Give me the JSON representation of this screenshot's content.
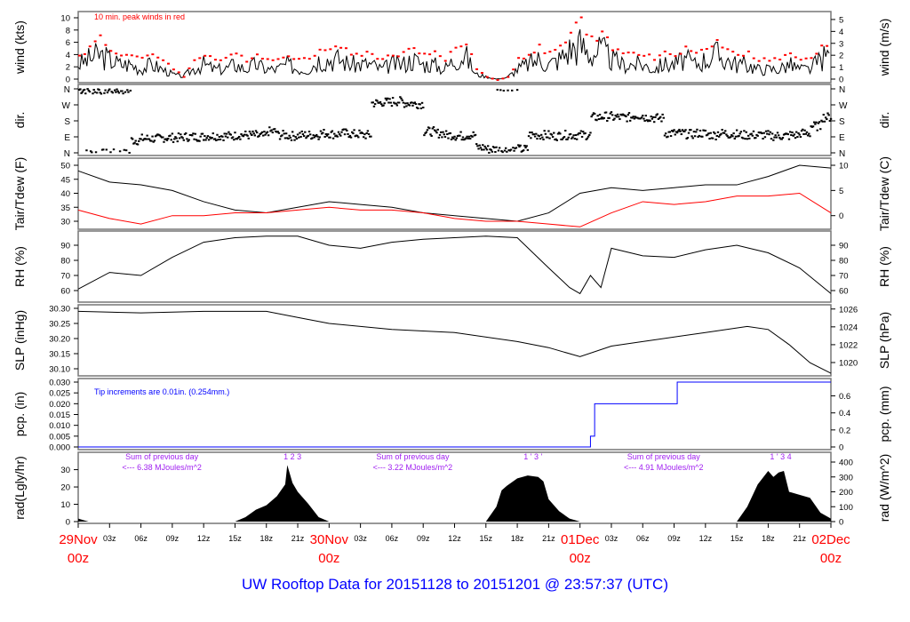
{
  "title": "UW Rooftop Data for 20151128  to  20151201 @ 23:57:37  (UTC)",
  "chart_data": [
    {
      "id": "wind",
      "type": "line",
      "ylabel_left": "wind (kts)",
      "ylabel_right": "wind (m/s)",
      "ylim": [
        0,
        10
      ],
      "yticks_left": [
        0,
        2,
        4,
        6,
        8,
        10
      ],
      "yticks_right": [
        0,
        1,
        2,
        3,
        4,
        5
      ],
      "annotation": "10 min. peak winds in red",
      "x_hours": [
        0,
        1,
        2,
        3,
        4,
        5,
        6,
        7,
        8,
        9,
        10,
        11,
        12,
        13,
        14,
        15,
        16,
        17,
        18,
        19,
        20,
        21,
        22,
        23,
        24,
        25,
        26,
        27,
        28,
        29,
        30,
        31,
        32,
        33,
        34,
        35,
        36,
        37,
        38,
        39,
        40,
        41,
        42,
        43,
        44,
        45,
        46,
        47,
        48,
        49,
        50,
        51,
        52,
        53,
        54,
        55,
        56,
        57,
        58,
        59,
        60,
        61,
        62,
        63,
        64,
        65,
        66,
        67,
        68,
        69,
        70,
        71,
        72
      ],
      "series": [
        {
          "name": "wind",
          "color": "#000000",
          "values": [
            3,
            4,
            5,
            4,
            3,
            3,
            2,
            3,
            2,
            1,
            0.5,
            2,
            3,
            2,
            2,
            3,
            2,
            3,
            2,
            2,
            3,
            2,
            2,
            4,
            4,
            4,
            3,
            3,
            3,
            2,
            3,
            3,
            4,
            3,
            3,
            2,
            4,
            5,
            1,
            0.5,
            0,
            0.3,
            2,
            3,
            4,
            3,
            4,
            6,
            7,
            5,
            6,
            4,
            3,
            3,
            3,
            2,
            3,
            3,
            4,
            3,
            4,
            5,
            4,
            3,
            3,
            2,
            2,
            2,
            3,
            2,
            2,
            4,
            5
          ]
        },
        {
          "name": "10 min. peak",
          "color": "#ff0000",
          "values": [
            4.3,
            5.5,
            7.5,
            5,
            4.5,
            4.2,
            3.5,
            4.5,
            3.5,
            2,
            0.5,
            3.5,
            4.5,
            3.5,
            3.5,
            4.5,
            3.5,
            4.5,
            3.5,
            3.5,
            4.5,
            3.5,
            3.5,
            5.5,
            5.8,
            5.5,
            4.5,
            4.5,
            4.5,
            3.5,
            4.5,
            4.5,
            5.5,
            4.5,
            4.5,
            3.5,
            5.5,
            6.5,
            2,
            0.5,
            0,
            0.5,
            3.5,
            4.5,
            5.5,
            4.5,
            5.5,
            8,
            10,
            7,
            8,
            5.5,
            4.5,
            4.5,
            4.5,
            3.5,
            4.5,
            4.5,
            5.5,
            4.5,
            5.5,
            6.5,
            5.5,
            4.5,
            4.5,
            3.5,
            3.5,
            3.5,
            4.5,
            3.5,
            3.5,
            5.5,
            6.5
          ]
        }
      ]
    },
    {
      "id": "dir",
      "type": "scatter",
      "ylabel_left": "dir.",
      "ylabel_right": "dir.",
      "ylim": [
        0,
        360
      ],
      "ytick_labels": [
        "N",
        "E",
        "S",
        "W",
        "N"
      ],
      "x_hours": [
        0,
        1,
        2,
        3,
        4,
        5,
        6,
        7,
        8,
        9,
        10,
        11,
        12,
        13,
        14,
        15,
        16,
        17,
        18,
        19,
        20,
        21,
        22,
        23,
        24,
        25,
        26,
        27,
        28,
        29,
        30,
        31,
        32,
        33,
        34,
        35,
        36,
        37,
        38,
        39,
        40,
        41,
        42,
        43,
        44,
        45,
        46,
        47,
        48,
        49,
        50,
        51,
        52,
        53,
        54,
        55,
        56,
        57,
        58,
        59,
        60,
        61,
        62,
        63,
        64,
        65,
        66,
        67,
        68,
        69,
        70,
        71,
        72
      ],
      "values": [
        355,
        355,
        355,
        355,
        355,
        70,
        80,
        80,
        85,
        85,
        90,
        90,
        95,
        95,
        95,
        100,
        100,
        95,
        120,
        100,
        95,
        100,
        100,
        110,
        105,
        110,
        105,
        100,
        280,
        285,
        290,
        280,
        275,
        120,
        110,
        100,
        95,
        100,
        30,
        20,
        15,
        15,
        20,
        100,
        100,
        95,
        100,
        100,
        100,
        200,
        205,
        200,
        200,
        210,
        200,
        195,
        110,
        110,
        105,
        110,
        100,
        110,
        105,
        100,
        100,
        100,
        95,
        95,
        100,
        110,
        150,
        200,
        220
      ]
    },
    {
      "id": "temp",
      "type": "line",
      "ylabel_left": "Tair/Tdew (F)",
      "ylabel_right": "Tair/Tdew (C)",
      "ylim": [
        30,
        50
      ],
      "yticks_left": [
        30,
        35,
        40,
        45,
        50
      ],
      "yticks_right": [
        0,
        5,
        10
      ],
      "x_hours": [
        0,
        3,
        6,
        9,
        12,
        15,
        18,
        21,
        24,
        27,
        30,
        33,
        36,
        39,
        42,
        45,
        48,
        51,
        54,
        57,
        60,
        63,
        66,
        69,
        72
      ],
      "series": [
        {
          "name": "Tair",
          "color": "#000000",
          "values": [
            48,
            44,
            43,
            41,
            37,
            34,
            33,
            35,
            37,
            36,
            35,
            33,
            32,
            31,
            30,
            33,
            40,
            42,
            41,
            42,
            43,
            43,
            46,
            50,
            49
          ]
        },
        {
          "name": "Tdew",
          "color": "#ff0000",
          "values": [
            34,
            31,
            29,
            32,
            32,
            33,
            33,
            34,
            35,
            34,
            34,
            33,
            31,
            30,
            30,
            29,
            28,
            33,
            37,
            36,
            37,
            39,
            39,
            40,
            33
          ]
        }
      ]
    },
    {
      "id": "rh",
      "type": "line",
      "ylabel_left": "RH (%)",
      "ylabel_right": "RH (%)",
      "ylim": [
        60,
        90
      ],
      "yticks_left": [
        60,
        70,
        80,
        90
      ],
      "yticks_right": [
        60,
        70,
        80,
        90
      ],
      "x_hours": [
        0,
        3,
        6,
        9,
        12,
        15,
        18,
        21,
        24,
        27,
        30,
        33,
        36,
        39,
        42,
        45,
        47,
        48,
        49,
        50,
        51,
        54,
        57,
        60,
        63,
        66,
        69,
        72
      ],
      "series": [
        {
          "name": "RH",
          "color": "#000000",
          "values": [
            61,
            72,
            70,
            82,
            92,
            95,
            96,
            96,
            90,
            88,
            92,
            94,
            95,
            96,
            95,
            75,
            62,
            58,
            70,
            62,
            88,
            83,
            82,
            87,
            90,
            85,
            75,
            58
          ]
        }
      ]
    },
    {
      "id": "slp",
      "type": "line",
      "ylabel_left": "SLP (inHg)",
      "ylabel_right": "SLP (hPa)",
      "ylim": [
        30.1,
        30.3
      ],
      "yticks_left": [
        "30.10",
        "30.15",
        "30.20",
        "30.25",
        "30.30"
      ],
      "yticks_right": [
        1020,
        1022,
        1024,
        1026
      ],
      "x_hours": [
        0,
        6,
        12,
        18,
        21,
        24,
        30,
        36,
        42,
        45,
        48,
        51,
        54,
        60,
        64,
        66,
        68,
        70,
        72
      ],
      "series": [
        {
          "name": "SLP",
          "color": "#000000",
          "values": [
            30.29,
            30.285,
            30.29,
            30.29,
            30.27,
            30.25,
            30.23,
            30.22,
            30.19,
            30.17,
            30.14,
            30.175,
            30.19,
            30.22,
            30.24,
            30.23,
            30.18,
            30.12,
            30.085
          ]
        }
      ]
    },
    {
      "id": "pcp",
      "type": "step",
      "ylabel_left": "pcp. (in)",
      "ylabel_right": "pcp. (mm)",
      "ylim": [
        0,
        0.03
      ],
      "yticks_left": [
        "0.000",
        "0.005",
        "0.010",
        "0.015",
        "0.020",
        "0.025",
        "0.030"
      ],
      "yticks_right": [
        "0",
        "0.2",
        "0.4",
        "0.6"
      ],
      "annotation": "Tip increments are 0.01in. (0.254mm.)",
      "x_hours": [
        0,
        49.0,
        49.4,
        57.3,
        72
      ],
      "series": [
        {
          "name": "pcp",
          "color": "#0000ff",
          "values": [
            0,
            0.005,
            0.02,
            0.03,
            0.03
          ]
        }
      ]
    },
    {
      "id": "rad",
      "type": "area",
      "ylabel_left": "rad(Lgly/hr)",
      "ylabel_right": "rad (W/m^2)",
      "ylim": [
        0,
        400
      ],
      "yticks_left": [
        0,
        10,
        20,
        30
      ],
      "yticks_right": [
        0,
        100,
        200,
        300,
        400
      ],
      "x_hours": [
        0,
        0.5,
        1,
        15,
        16,
        17,
        18,
        19,
        19.8,
        20,
        20.5,
        21,
        22,
        23,
        24,
        39,
        40,
        40.5,
        41,
        42,
        43,
        44,
        44.5,
        45,
        46,
        47,
        48,
        63,
        64,
        65,
        66,
        66.5,
        67,
        67.5,
        68,
        69,
        70,
        71,
        72
      ],
      "series": [
        {
          "name": "rad",
          "color": "#000000",
          "values": [
            20,
            10,
            0,
            0,
            30,
            80,
            110,
            170,
            250,
            380,
            260,
            200,
            120,
            30,
            0,
            0,
            100,
            210,
            240,
            290,
            310,
            300,
            270,
            150,
            70,
            20,
            0,
            0,
            100,
            250,
            340,
            300,
            330,
            340,
            200,
            180,
            160,
            60,
            20
          ]
        }
      ],
      "day_markers": [
        {
          "hour": 20.5,
          "labels": "1   2      3"
        },
        {
          "hour": 43.5,
          "labels": "1   '   3   '"
        },
        {
          "hour": 67.2,
          "labels": "1   '   3      4"
        }
      ],
      "daily_sums": [
        {
          "line1": "Sum of previous day",
          "line2": "<--- 6.38 MJoules/m^2",
          "hour": 8
        },
        {
          "line1": "Sum of previous day",
          "line2": "<--- 3.22 MJoules/m^2",
          "hour": 32
        },
        {
          "line1": "Sum of previous day",
          "line2": "<--- 4.91 MJoules/m^2",
          "hour": 56
        }
      ]
    }
  ],
  "xaxis": {
    "hour_ticks": [
      "03z",
      "06z",
      "09z",
      "12z",
      "15z",
      "18z",
      "21z"
    ],
    "days": [
      {
        "hour": 0,
        "date": "29Nov",
        "time": "00z"
      },
      {
        "hour": 24,
        "date": "30Nov",
        "time": "00z"
      },
      {
        "hour": 48,
        "date": "01Dec",
        "time": "00z"
      },
      {
        "hour": 72,
        "date": "02Dec",
        "time": "00z"
      }
    ]
  },
  "colors": {
    "peak": "#ff0000",
    "dew": "#ff0000",
    "pcp": "#0000ff",
    "annot": "#a020f0",
    "day": "#ff0000",
    "title": "#0000ff"
  }
}
